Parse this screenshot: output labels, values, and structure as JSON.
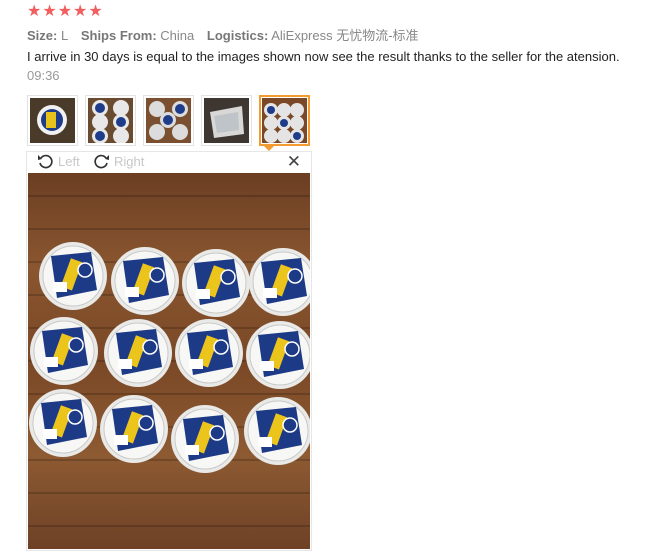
{
  "rating": {
    "stars": 5,
    "color": "#f25d5d",
    "icon": "star-icon"
  },
  "meta": {
    "size_label": "Size:",
    "size_value": "L",
    "ships_label": "Ships From:",
    "ships_value": "China",
    "logistics_label": "Logistics:",
    "logistics_value": "AliExpress 无忧物流-标准"
  },
  "review": {
    "text": "I arrive in 30 days is equal to the images shown now see the result thanks to the seller for the atension.",
    "time": "09:36"
  },
  "thumbnails": {
    "count": 5,
    "selected_index": 4,
    "accent": "#f39b31"
  },
  "viewer": {
    "rotate_left_label": "Left",
    "rotate_right_label": "Right",
    "close_icon": "close-icon",
    "rotate_left_icon": "rotate-left-icon",
    "rotate_right_icon": "rotate-right-icon"
  }
}
